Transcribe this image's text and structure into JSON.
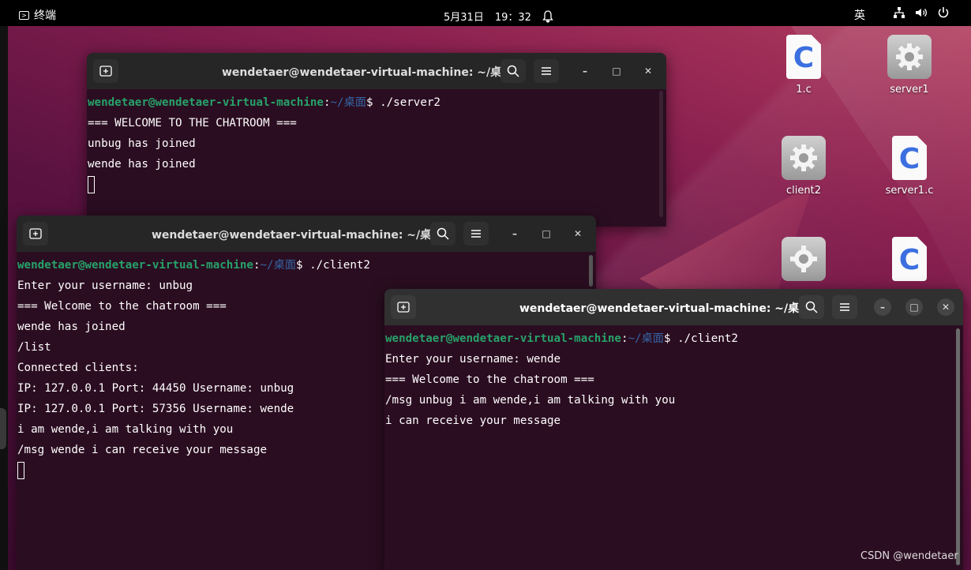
{
  "topbar": {
    "app_name": "终端",
    "date": "5月31日",
    "time": "19：32",
    "ime": "英",
    "icons": [
      "terminal-icon",
      "bell-icon",
      "network-icon",
      "volume-icon",
      "power-icon"
    ]
  },
  "desktop_icons": [
    {
      "label": "1.c",
      "type": "c-file"
    },
    {
      "label": "server1",
      "type": "executable"
    },
    {
      "label": "client2",
      "type": "executable"
    },
    {
      "label": "server1.c",
      "type": "c-file"
    },
    {
      "label": "",
      "type": "executable"
    },
    {
      "label": "",
      "type": "c-file"
    }
  ],
  "windows": {
    "server": {
      "title": "wendetaer@wendetaer-virtual-machine: ~/桌面",
      "prompt_user": "wendetaer@wendetaer-virtual-machine",
      "prompt_path": "~/桌面",
      "command": "$ ./server2",
      "lines": [
        "=== WELCOME TO THE CHATROOM ===",
        "unbug has joined",
        "wende has joined"
      ]
    },
    "client_unbug": {
      "title": "wendetaer@wendetaer-virtual-machine: ~/桌面",
      "prompt_user": "wendetaer@wendetaer-virtual-machine",
      "prompt_path": "~/桌面",
      "command": "$ ./client2",
      "lines": [
        "Enter your username: unbug",
        "=== Welcome to the chatroom ===",
        "wende has joined",
        "/list",
        "Connected clients:",
        "IP: 127.0.0.1 Port: 44450 Username: unbug",
        "IP: 127.0.0.1 Port: 57356 Username: wende",
        "i am wende,i am talking with you",
        "/msg wende i can receive your message"
      ]
    },
    "client_wende": {
      "title": "wendetaer@wendetaer-virtual-machine: ~/桌面",
      "prompt_user": "wendetaer@wendetaer-virtual-machine",
      "prompt_path": "~/桌面",
      "command": "$ ./client2",
      "lines": [
        "Enter your username: wende",
        "=== Welcome to the chatroom ===",
        "/msg unbug i am wende,i am talking with you",
        "i can receive your message"
      ]
    }
  },
  "colors": {
    "prompt_user": "#26a269",
    "prompt_path": "#3465a4",
    "terminal_bg": "#2b0d21"
  },
  "watermark": "CSDN @wendetaer"
}
